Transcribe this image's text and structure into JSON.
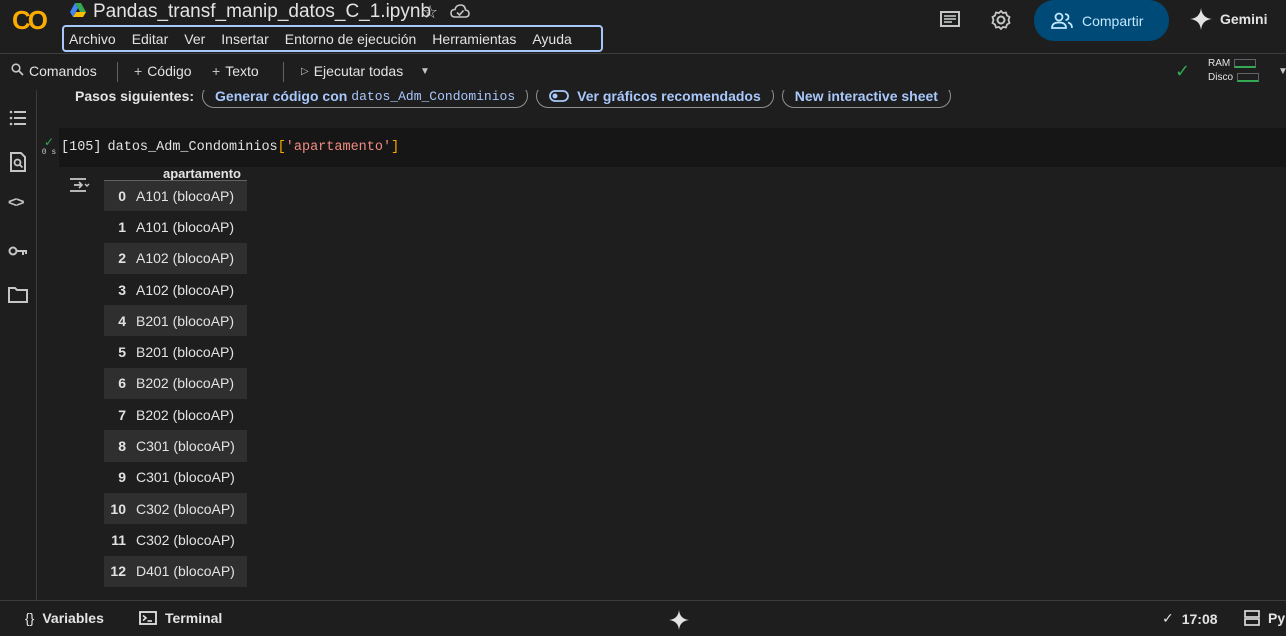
{
  "header": {
    "notebook_title": "Pandas_transf_manip_datos_C_1.ipynb",
    "logo_text": "CO",
    "menu": [
      "Archivo",
      "Editar",
      "Ver",
      "Insertar",
      "Entorno de ejecución",
      "Herramientas",
      "Ayuda"
    ],
    "share_label": "Compartir",
    "gemini_label": "Gemini",
    "accent": "#004a77"
  },
  "toolbar": {
    "commands_label": "Comandos",
    "code_label": "Código",
    "text_label": "Texto",
    "run_all_label": "Ejecutar todas",
    "ram_label": "RAM",
    "disk_label": "Disco"
  },
  "next_steps": {
    "label": "Pasos siguientes:",
    "chip_generate_prefix": "Generar código con",
    "chip_generate_var": "datos_Adm_Condominios",
    "chip_charts": "Ver gráficos recomendados",
    "chip_sheet": "New interactive sheet"
  },
  "cell": {
    "exec_count": "[105]",
    "code_ident": "datos_Adm_Condominios",
    "code_open": "[",
    "code_string": "'apartamento'",
    "code_close": "]",
    "elapsed": "0 s"
  },
  "output": {
    "column_header": "apartamento",
    "rows": [
      {
        "index": "0",
        "value": "A101 (blocoAP)"
      },
      {
        "index": "1",
        "value": "A101 (blocoAP)"
      },
      {
        "index": "2",
        "value": "A102 (blocoAP)"
      },
      {
        "index": "3",
        "value": "A102 (blocoAP)"
      },
      {
        "index": "4",
        "value": "B201 (blocoAP)"
      },
      {
        "index": "5",
        "value": "B201 (blocoAP)"
      },
      {
        "index": "6",
        "value": "B202 (blocoAP)"
      },
      {
        "index": "7",
        "value": "B202 (blocoAP)"
      },
      {
        "index": "8",
        "value": "C301 (blocoAP)"
      },
      {
        "index": "9",
        "value": "C301 (blocoAP)"
      },
      {
        "index": "10",
        "value": "C302 (blocoAP)"
      },
      {
        "index": "11",
        "value": "C302 (blocoAP)"
      },
      {
        "index": "12",
        "value": "D401 (blocoAP)"
      }
    ]
  },
  "statusbar": {
    "variables_label": "Variables",
    "terminal_label": "Terminal",
    "time": "17:08",
    "runtime_label": "Py"
  }
}
